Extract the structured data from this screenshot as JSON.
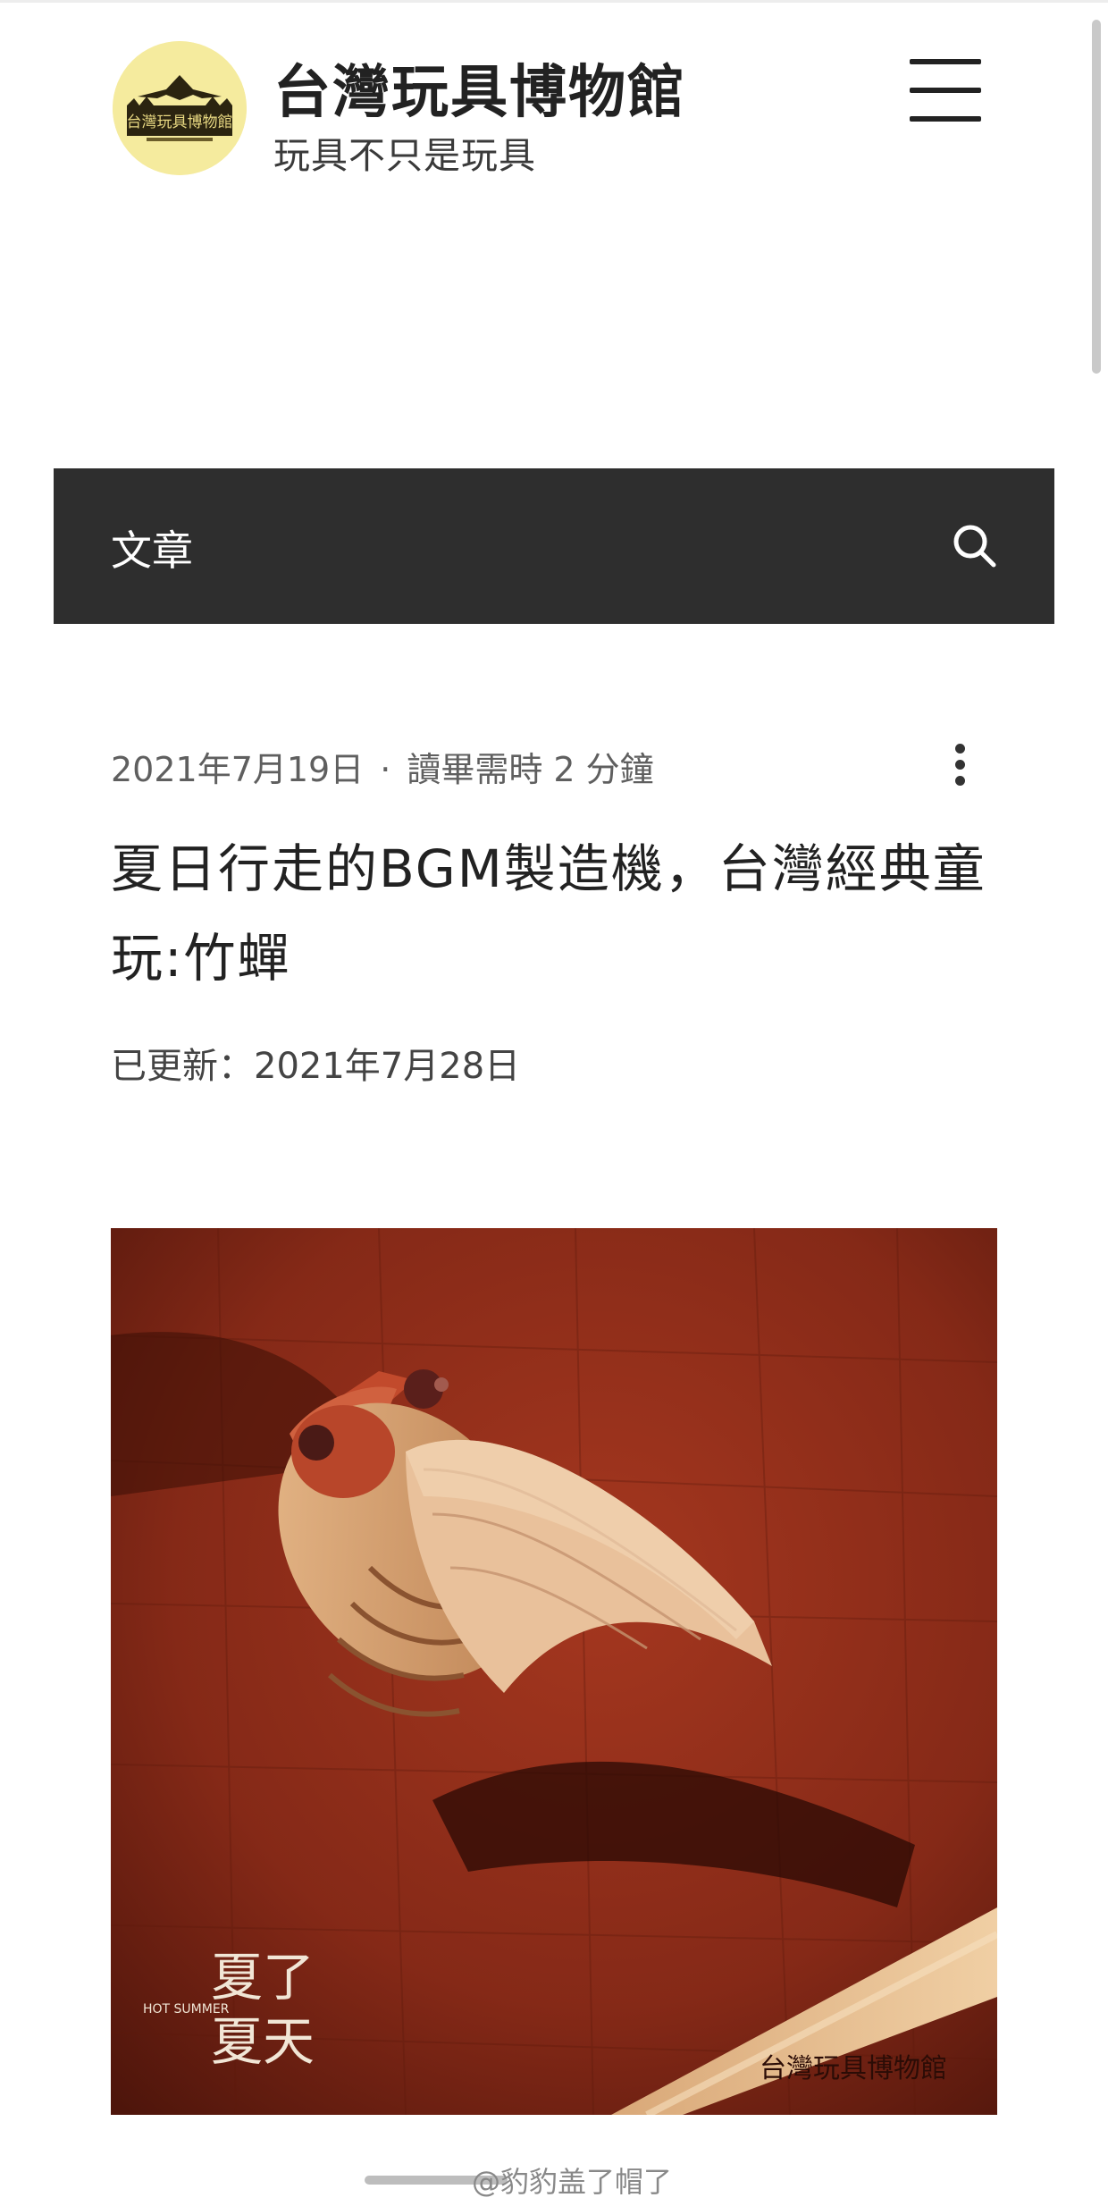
{
  "site": {
    "title": "台灣玩具博物館",
    "tagline": "玩具不只是玩具",
    "logo_text": "台灣玩具博物館"
  },
  "icons": {
    "menu": "hamburger-menu-icon",
    "search": "search-icon",
    "more": "more-vertical-icon"
  },
  "category": {
    "label": "文章"
  },
  "post": {
    "date": "2021年7月19日",
    "separator": "·",
    "read_time": "讀畢需時 2 分鐘",
    "title": "夏日行走的BGM製造機，台灣經典童玩:竹蟬",
    "updated": "已更新：2021年7月28日",
    "image": {
      "caption_vertical_1": "夏了",
      "caption_vertical_2": "夏天",
      "caption_en": "HOT SUMMER",
      "watermark": "台灣玩具博物館"
    }
  },
  "footer_watermark": "@豹豹盖了帽了",
  "colors": {
    "nav_bar": "#2e2e2e",
    "logo_bg": "#f5eb9e",
    "image_bg": "#8a2a17"
  }
}
